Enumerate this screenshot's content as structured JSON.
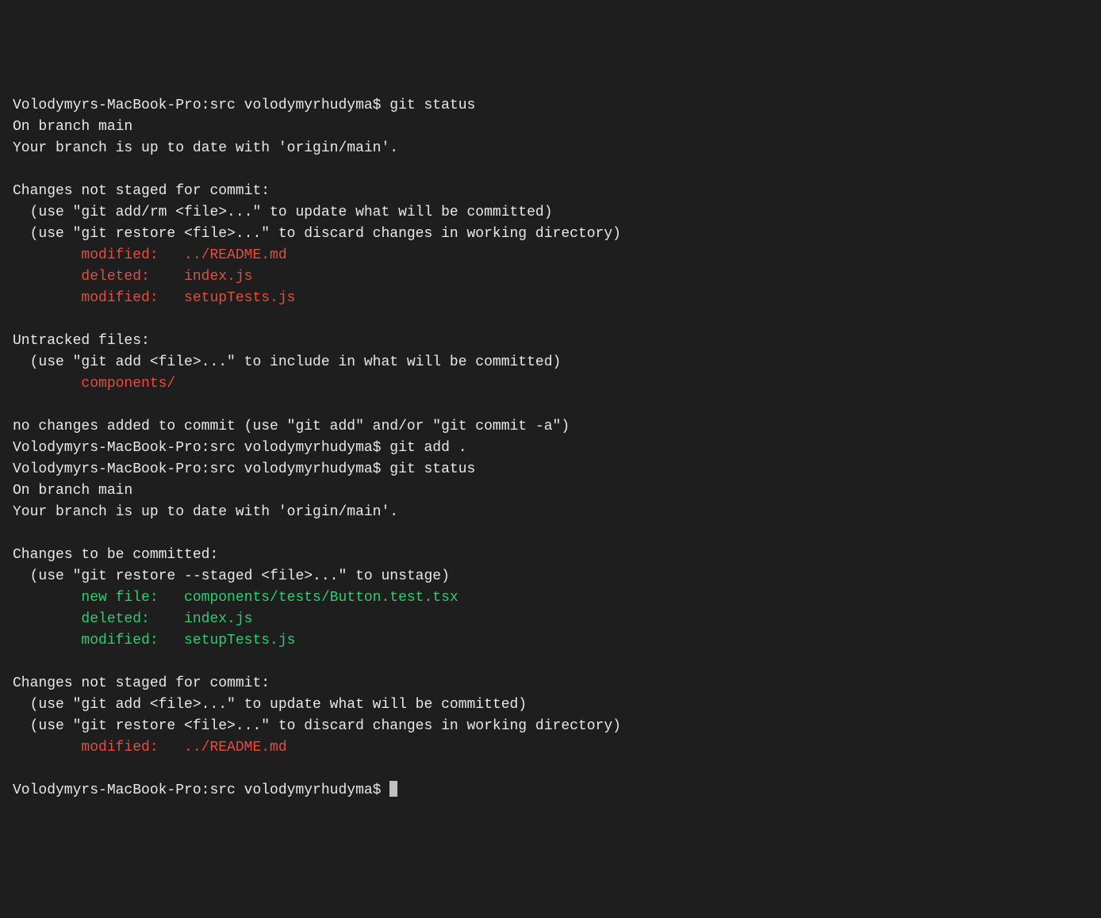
{
  "prompt": "Volodymyrs-MacBook-Pro:src volodymyrhudyma$ ",
  "cmd1": "git status",
  "status1_line1": "On branch main",
  "status1_line2": "Your branch is up to date with 'origin/main'.",
  "status1_changes_header": "Changes not staged for commit:",
  "status1_hint1": "  (use \"git add/rm <file>...\" to update what will be committed)",
  "status1_hint2": "  (use \"git restore <file>...\" to discard changes in working directory)",
  "status1_modified1": "        modified:   ../README.md",
  "status1_deleted": "        deleted:    index.js",
  "status1_modified2": "        modified:   setupTests.js",
  "status1_untracked_header": "Untracked files:",
  "status1_untracked_hint": "  (use \"git add <file>...\" to include in what will be committed)",
  "status1_untracked_file": "        components/",
  "status1_footer": "no changes added to commit (use \"git add\" and/or \"git commit -a\")",
  "cmd2": "git add .",
  "cmd3": "git status",
  "status2_line1": "On branch main",
  "status2_line2": "Your branch is up to date with 'origin/main'.",
  "status2_changes_header": "Changes to be committed:",
  "status2_hint1": "  (use \"git restore --staged <file>...\" to unstage)",
  "status2_newfile": "        new file:   components/tests/Button.test.tsx",
  "status2_deleted": "        deleted:    index.js",
  "status2_modified": "        modified:   setupTests.js",
  "status2_unstaged_header": "Changes not staged for commit:",
  "status2_unstaged_hint1": "  (use \"git add <file>...\" to update what will be committed)",
  "status2_unstaged_hint2": "  (use \"git restore <file>...\" to discard changes in working directory)",
  "status2_unstaged_modified": "        modified:   ../README.md"
}
